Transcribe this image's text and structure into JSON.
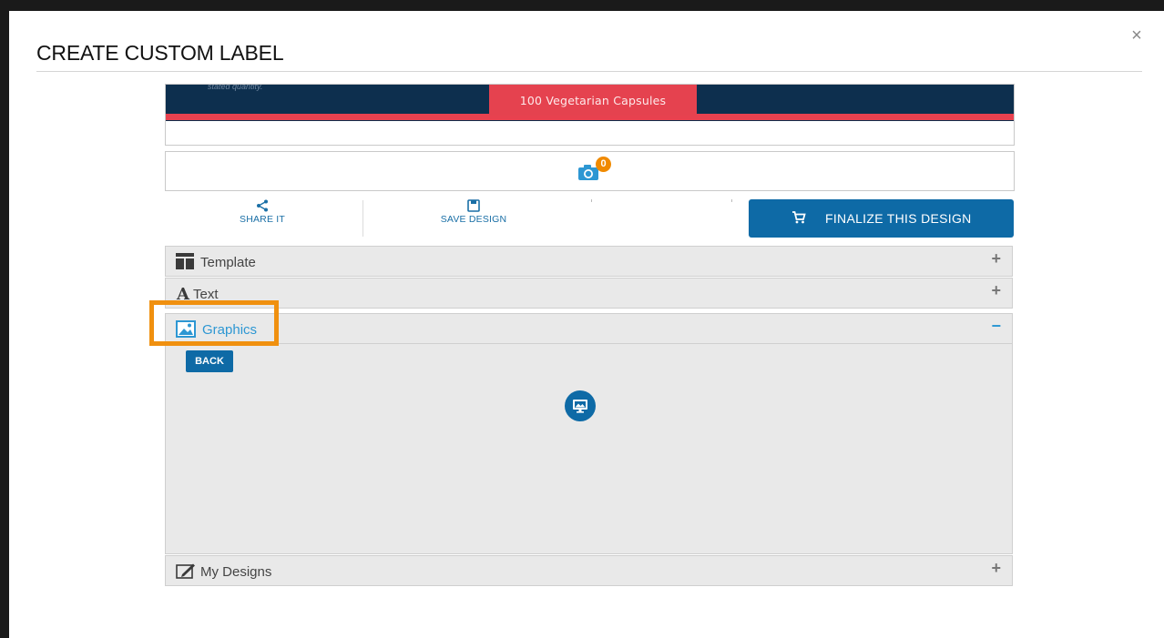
{
  "modal": {
    "title": "CREATE CUSTOM LABEL",
    "close_symbol": "×"
  },
  "preview": {
    "fine_print": "stated quantity.",
    "subtitle": "100 Vegetarian Capsules",
    "colors": {
      "navy": "#0d2f4e",
      "red": "#e5424f"
    }
  },
  "photos": {
    "icon": "camera-icon",
    "count": "0"
  },
  "actions": {
    "share_label": "SHARE IT",
    "save_label": "SAVE DESIGN",
    "finalize_label": "FINALIZE THIS DESIGN"
  },
  "accordion": {
    "template": {
      "label": "Template",
      "toggle": "+",
      "icon": "template-icon"
    },
    "text": {
      "label": "Text",
      "toggle": "+",
      "icon": "text-icon"
    },
    "graphics": {
      "label": "Graphics",
      "toggle": "−",
      "icon": "image-icon",
      "expanded": true
    },
    "my_designs": {
      "label": "My Designs",
      "toggle": "+",
      "icon": "designs-icon"
    }
  },
  "graphics_panel": {
    "back_label": "BACK",
    "upload_icon": "computer-icon"
  },
  "colors": {
    "primary": "#0e6aa6",
    "accent_link": "#2d97d3",
    "highlight": "#f0900f",
    "badge": "#f08a00"
  }
}
